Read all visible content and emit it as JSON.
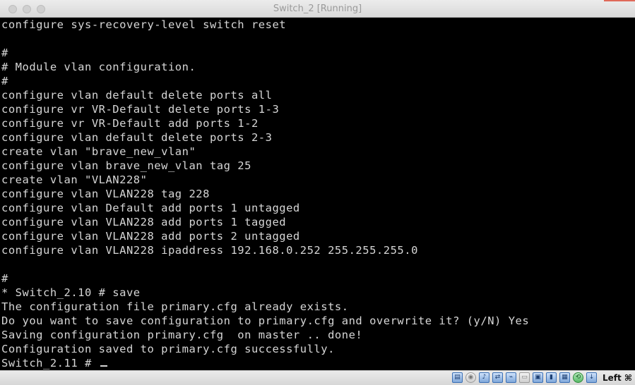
{
  "window": {
    "title": "Switch_2 [Running]"
  },
  "terminal": {
    "lines": [
      "configure sys-recovery-level switch reset",
      "",
      "#",
      "# Module vlan configuration.",
      "#",
      "configure vlan default delete ports all",
      "configure vr VR-Default delete ports 1-3",
      "configure vr VR-Default add ports 1-2",
      "configure vlan default delete ports 2-3",
      "create vlan \"brave_new_vlan\"",
      "configure vlan brave_new_vlan tag 25",
      "create vlan \"VLAN228\"",
      "configure vlan VLAN228 tag 228",
      "configure vlan Default add ports 1 untagged",
      "configure vlan VLAN228 add ports 1 tagged",
      "configure vlan VLAN228 add ports 2 untagged",
      "configure vlan VLAN228 ipaddress 192.168.0.252 255.255.255.0",
      "",
      "#",
      "* Switch_2.10 # save",
      "The configuration file primary.cfg already exists.",
      "Do you want to save configuration to primary.cfg and overwrite it? (y/N) Yes",
      "Saving configuration primary.cfg  on master .. done!",
      "Configuration saved to primary.cfg successfully.",
      "Switch_2.11 # "
    ]
  },
  "statusbar": {
    "icons": [
      "harddisk-icon",
      "optical-drive-icon",
      "audio-icon",
      "network-icon",
      "usb-icon",
      "shared-folder-icon",
      "display-icon",
      "video-capture-icon",
      "virtualization-icon",
      "mouse-integration-icon",
      "keyboard-capture-icon"
    ],
    "host_key": "Left ⌘"
  }
}
